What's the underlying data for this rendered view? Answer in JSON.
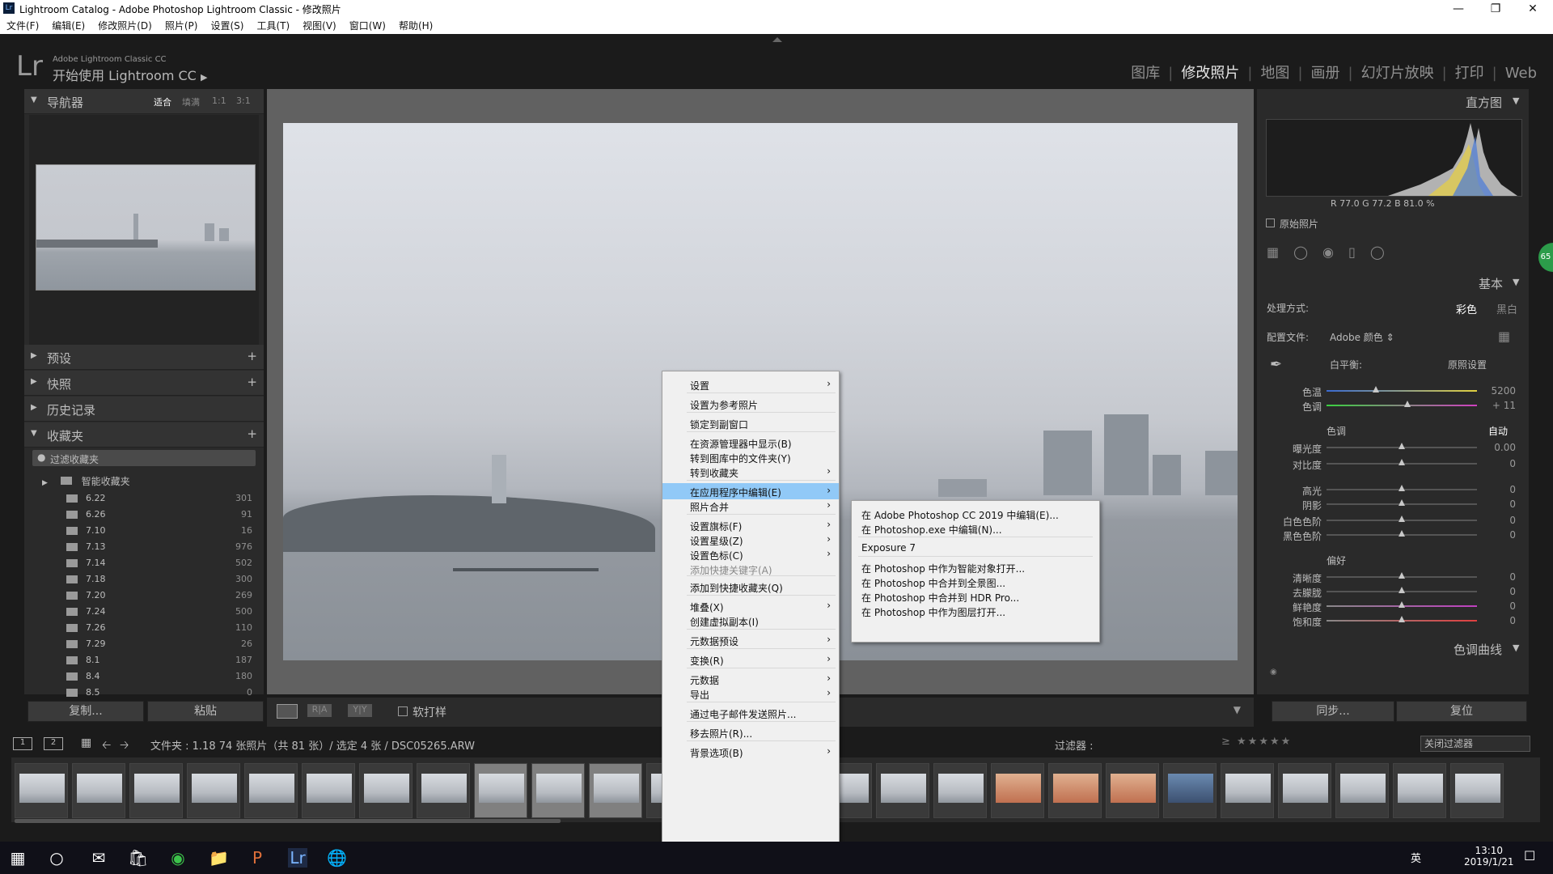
{
  "window": {
    "title": "Lightroom Catalog - Adobe Photoshop Lightroom Classic - 修改照片",
    "app_icon": "Lr"
  },
  "menubar": [
    "文件(F)",
    "编辑(E)",
    "修改照片(D)",
    "照片(P)",
    "设置(S)",
    "工具(T)",
    "视图(V)",
    "窗口(W)",
    "帮助(H)"
  ],
  "identity": {
    "logo": "Lr",
    "subtitle": "Adobe Lightroom Classic CC",
    "get_started": "开始使用 Lightroom CC"
  },
  "modules": [
    "图库",
    "修改照片",
    "地图",
    "画册",
    "幻灯片放映",
    "打印",
    "Web"
  ],
  "active_module": "修改照片",
  "left_panel": {
    "navigator": {
      "title": "导航器",
      "zoom": [
        "适合",
        "填满",
        "1:1",
        "3:1"
      ]
    },
    "presets": "预设",
    "snapshots": "快照",
    "history": "历史记录",
    "collections": {
      "title": "收藏夹",
      "filter": "过滤收藏夹",
      "smart": "智能收藏夹",
      "items": [
        {
          "name": "6.22",
          "count": "301"
        },
        {
          "name": "6.26",
          "count": "91"
        },
        {
          "name": "7.10",
          "count": "16"
        },
        {
          "name": "7.13",
          "count": "976"
        },
        {
          "name": "7.14",
          "count": "502"
        },
        {
          "name": "7.18",
          "count": "300"
        },
        {
          "name": "7.20",
          "count": "269"
        },
        {
          "name": "7.24",
          "count": "500"
        },
        {
          "name": "7.26",
          "count": "110"
        },
        {
          "name": "7.29",
          "count": "26"
        },
        {
          "name": "8.1",
          "count": "187"
        },
        {
          "name": "8.4",
          "count": "180"
        },
        {
          "name": "8.5",
          "count": "0"
        }
      ]
    },
    "copy_btn": "复制...",
    "paste_btn": "粘贴"
  },
  "toolbar": {
    "softproof": "软打样"
  },
  "right_panel": {
    "histogram": {
      "title": "直方图",
      "readout": "R 77.0  G 77.2  B 81.0 %",
      "original": "原始照片"
    },
    "basic": {
      "title": "基本",
      "treatment_label": "处理方式:",
      "color": "彩色",
      "bw": "黑白",
      "profile_label": "配置文件:",
      "profile": "Adobe 颜色",
      "wb_label": "白平衡:",
      "wb_value": "原照设置",
      "tone_label": "色调",
      "auto": "自动",
      "presence_label": "偏好"
    },
    "sliders": [
      {
        "label": "色温",
        "value": "5200",
        "pos": 0.33
      },
      {
        "label": "色调",
        "value": "+ 11",
        "pos": 0.54
      },
      {
        "label": "曝光度",
        "value": "0.00",
        "pos": 0.5
      },
      {
        "label": "对比度",
        "value": "0",
        "pos": 0.5
      },
      {
        "label": "高光",
        "value": "0",
        "pos": 0.5
      },
      {
        "label": "阴影",
        "value": "0",
        "pos": 0.5
      },
      {
        "label": "白色色阶",
        "value": "0",
        "pos": 0.5
      },
      {
        "label": "黑色色阶",
        "value": "0",
        "pos": 0.5
      },
      {
        "label": "清晰度",
        "value": "0",
        "pos": 0.5
      },
      {
        "label": "去朦胧",
        "value": "0",
        "pos": 0.5
      },
      {
        "label": "鲜艳度",
        "value": "0",
        "pos": 0.5
      },
      {
        "label": "饱和度",
        "value": "0",
        "pos": 0.5
      }
    ],
    "tone_curve": "色调曲线",
    "sync_btn": "同步...",
    "reset_btn": "复位"
  },
  "filmstrip_bar": {
    "folder_info": "文件夹 : 1.18   74 张照片（共 81 张）/ 选定 4 张 / DSC05265.ARW",
    "filter_label": "过滤器 :",
    "filter_value": "关闭过滤器"
  },
  "context_menu": [
    {
      "label": "设置",
      "submenu": true
    },
    {
      "label": "设置为参考照片"
    },
    {
      "label": "锁定到副窗口"
    },
    {
      "label": "在资源管理器中显示(B)"
    },
    {
      "label": "转到图库中的文件夹(Y)"
    },
    {
      "label": "转到收藏夹",
      "submenu": true
    },
    {
      "label": "在应用程序中编辑(E)",
      "submenu": true,
      "highlighted": true
    },
    {
      "label": "照片合并",
      "submenu": true
    },
    {
      "label": "设置旗标(F)",
      "submenu": true
    },
    {
      "label": "设置星级(Z)",
      "submenu": true
    },
    {
      "label": "设置色标(C)",
      "submenu": true
    },
    {
      "label": "添加快捷关键字(A)",
      "disabled": true
    },
    {
      "label": "添加到快捷收藏夹(Q)"
    },
    {
      "label": "堆叠(X)",
      "submenu": true
    },
    {
      "label": "创建虚拟副本(I)"
    },
    {
      "label": "元数据预设",
      "submenu": true
    },
    {
      "label": "变换(R)",
      "submenu": true
    },
    {
      "label": "元数据",
      "submenu": true
    },
    {
      "label": "导出",
      "submenu": true
    },
    {
      "label": "通过电子邮件发送照片..."
    },
    {
      "label": "移去照片(R)..."
    },
    {
      "label": "背景选项(B)",
      "submenu": true
    }
  ],
  "submenu": [
    "在 Adobe Photoshop CC 2019 中编辑(E)...",
    "在 Photoshop.exe 中编辑(N)...",
    "Exposure 7",
    "在 Photoshop 中作为智能对象打开...",
    "在 Photoshop 中合并到全景图...",
    "在 Photoshop 中合并到 HDR Pro...",
    "在 Photoshop 中作为图层打开..."
  ],
  "taskbar": {
    "time": "13:10",
    "date": "2019/1/21",
    "ime": "英"
  },
  "colors": {
    "accent_blue": "#91c9f7",
    "panel": "#2a2a2a",
    "bg": "#1b1b1b"
  }
}
